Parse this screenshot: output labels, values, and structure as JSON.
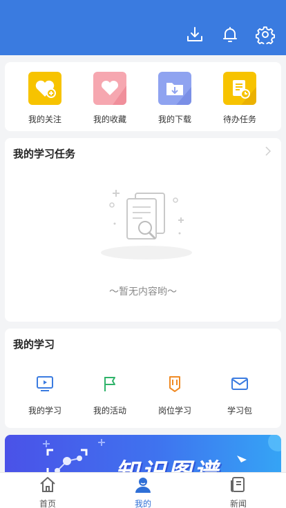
{
  "quick_actions": [
    {
      "label": "我的关注",
      "icon": "heart-plus-icon",
      "color": "#f7c300"
    },
    {
      "label": "我的收藏",
      "icon": "heart-icon",
      "color": "#f6a7b0"
    },
    {
      "label": "我的下载",
      "icon": "folder-download-icon",
      "color": "#8fa3f0"
    },
    {
      "label": "待办任务",
      "icon": "todo-document-icon",
      "color": "#f7c300"
    }
  ],
  "task_section": {
    "title": "我的学习任务",
    "empty_text": "～暂无内容哟～"
  },
  "study_section": {
    "title": "我的学习",
    "items": [
      {
        "label": "我的学习",
        "icon": "play-screen-icon",
        "color": "#3a7be0"
      },
      {
        "label": "我的活动",
        "icon": "flag-icon",
        "color": "#2fb36a"
      },
      {
        "label": "岗位学习",
        "icon": "badge-icon",
        "color": "#f08a24"
      },
      {
        "label": "学习包",
        "icon": "envelope-icon",
        "color": "#3a7be0"
      }
    ]
  },
  "banner": {
    "text": "知识图谱"
  },
  "tabs": [
    {
      "label": "首页",
      "icon": "home-icon"
    },
    {
      "label": "我的",
      "icon": "user-icon",
      "active": true
    },
    {
      "label": "新闻",
      "icon": "news-icon"
    }
  ],
  "colors": {
    "header": "#3a7be0",
    "active_tab": "#2f6fd6"
  }
}
